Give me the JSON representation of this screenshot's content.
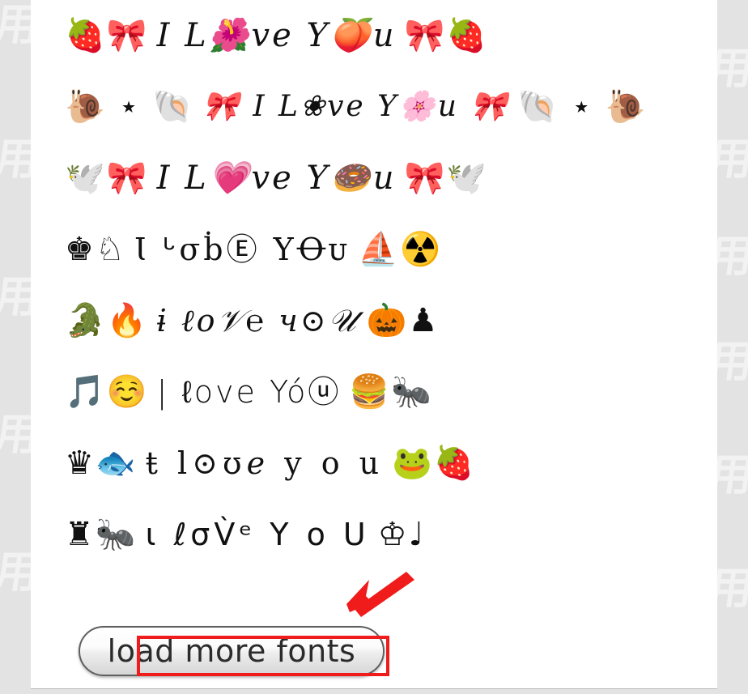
{
  "page": {
    "background_color": "#e3e3e3",
    "sheet_color": "#ffffff",
    "watermark_text": "用"
  },
  "font_rows": [
    {
      "id": "row-1",
      "left_decor": "🍓🎀",
      "phrase": "I L🌺ve Y🍑u",
      "right_decor": "🎀🍓",
      "style": "f-script"
    },
    {
      "id": "row-2",
      "left_decor": "🐌 ⋆ 🐚",
      "phrase": "🎀  I L❀ve Y🌸u  🎀",
      "right_decor": "🐚 ⋆ 🐌",
      "style": "f-serif-sm"
    },
    {
      "id": "row-3",
      "left_decor": "🕊️🎀",
      "phrase": "I L💗ve Y🍩u",
      "right_decor": "🎀🕊️",
      "style": "f-script"
    },
    {
      "id": "row-4",
      "left_decor": "♚♘",
      "phrase": "Ɩ ᒡσḃⒺ ΥꝊᴜ",
      "right_decor": "⛵☢️",
      "style": "f-outline"
    },
    {
      "id": "row-5",
      "left_decor": "🐊🔥",
      "phrase": "ɨ ℓo𝒱℮ ч⊙𝒰",
      "right_decor": "🎃♟",
      "style": "f-fancy"
    },
    {
      "id": "row-6",
      "left_decor": "🎵☺️",
      "phrase": "| ℓove Yóⓤ",
      "right_decor": "🍔🐜",
      "style": "f-hand"
    },
    {
      "id": "row-7",
      "left_decor": "♛🐟",
      "phrase": "ŧ l⊙ʊℯ y o u",
      "right_decor": "🐸🍓",
      "style": "f-mixed"
    },
    {
      "id": "row-8",
      "left_decor": "♜🐜",
      "phrase": "ɩ ℓσV̀ᵉ Y o U",
      "right_decor": "♔♩",
      "style": "f-thin"
    }
  ],
  "load_more_button": {
    "label": "load more fonts"
  },
  "annotations": {
    "box_color": "#f01c1c",
    "arrow_color": "#f01c1c",
    "arrow_name": "red-arrow-pointing-to-load-more-button"
  }
}
